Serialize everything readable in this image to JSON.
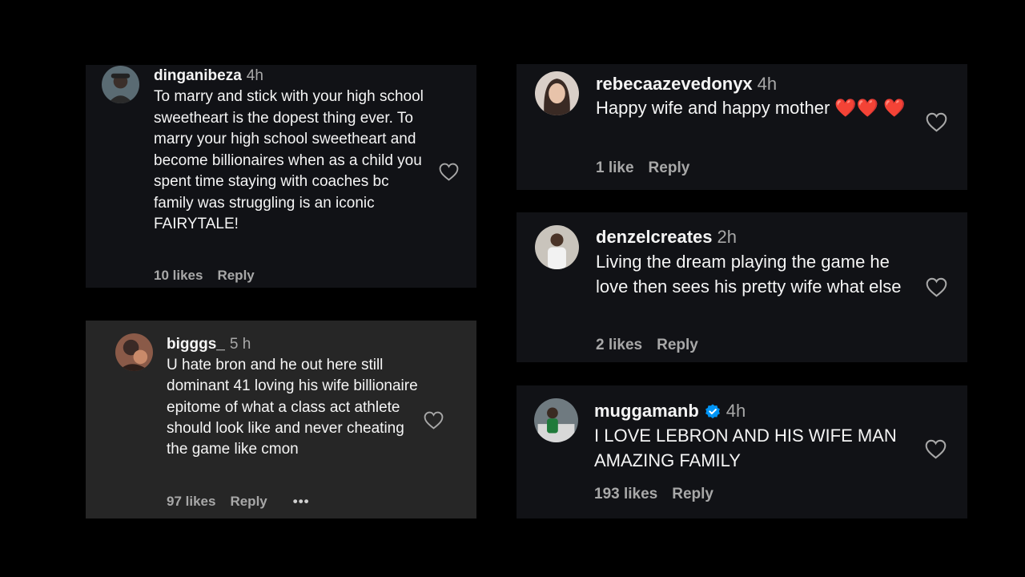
{
  "comments": [
    {
      "username": "dinganibeza",
      "time": "4h",
      "text": "To marry and stick with your high school sweetheart is the dopest thing ever. To marry your high school sweetheart and become billionaires when as a child you spent time staying with coaches bc family was struggling is an iconic FAIRYTALE!",
      "likes": "10 likes",
      "reply": "Reply"
    },
    {
      "username": "bigggs_",
      "time": "5 h",
      "text": "U hate bron and he out here still dominant 41 loving his wife billionaire epitome of what a class act athlete should look like and never cheating the game like cmon",
      "likes": "97 likes",
      "reply": "Reply",
      "more": "•••"
    },
    {
      "username": "rebecaazevedonyx",
      "time": "4h",
      "text": "Happy wife and happy mother ❤️❤️ ❤️",
      "likes": "1 like",
      "reply": "Reply"
    },
    {
      "username": "denzelcreates",
      "time": "2h",
      "text": "Living the dream playing the game he love then sees his pretty wife what else",
      "likes": "2 likes",
      "reply": "Reply"
    },
    {
      "username": "muggamanb",
      "time": "4h",
      "text": "I LOVE LEBRON AND HIS WIFE MAN AMAZING FAMILY",
      "likes": "193 likes",
      "reply": "Reply"
    }
  ],
  "icons": {
    "like": "heart-outline-icon",
    "verified": "verified-badge-icon",
    "more": "more-options-icon"
  },
  "colors": {
    "background": "#000000",
    "card": "#111216",
    "card_highlighted": "#262626",
    "secondary_text": "#a8a8a8",
    "verified": "#0095f6"
  }
}
